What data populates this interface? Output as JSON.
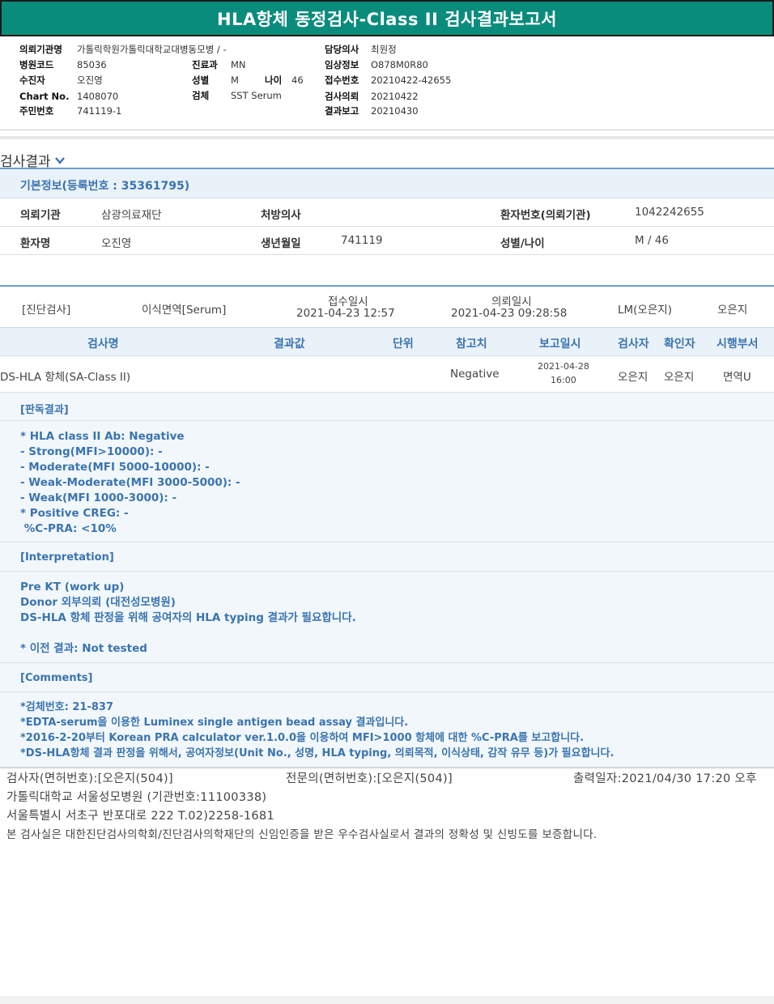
{
  "title": "HLA항체 동정검사-Class II 검사결과보고서",
  "header": {
    "col1": [
      {
        "label": "의뢰기관명",
        "value": "가톨릭학원가톨릭대학교대병동모병 / -"
      },
      {
        "label": "병원코드",
        "value": "85036"
      },
      {
        "label": "수진자",
        "value": "오진영"
      },
      {
        "label": "Chart No.",
        "value": "1408070"
      },
      {
        "label": "주민번호",
        "value": "741119-1"
      }
    ],
    "col2": [
      {
        "label": "진료과",
        "value": "MN"
      },
      {
        "label": "성별",
        "value": "M"
      },
      {
        "label": "나이",
        "value": "46"
      },
      {
        "label": "검체",
        "value": "SST Serum"
      }
    ],
    "col3": [
      {
        "label": "담당의사",
        "value": "최원정"
      },
      {
        "label": "임상정보",
        "value": "O878M0R80"
      },
      {
        "label": "접수번호",
        "value": "20210422-42655"
      },
      {
        "label": "검사의뢰",
        "value": "20210422"
      },
      {
        "label": "결과보고",
        "value": "20210430"
      }
    ]
  },
  "section": {
    "title": "검사결과",
    "basic_info_title": "기본정보(등록번호 : 35361795)"
  },
  "info": {
    "row1": {
      "l1": "의뢰기관",
      "v1": "삼광의료재단",
      "l2": "처방의사",
      "v2": "",
      "l3": "환자번호(의뢰기관)",
      "v3": "1042242655"
    },
    "row2": {
      "l1": "환자명",
      "v1": "오진영",
      "l2": "생년월일",
      "v2": "741119",
      "l3": "성별/나이",
      "v3": "M / 46"
    }
  },
  "rx": {
    "category": "[진단검사]",
    "dept": "이식면역[Serum]",
    "received_label": "접수일시",
    "received": "2021-04-23 12:57",
    "requested_label": "의뢰일시",
    "requested": "2021-04-23 09:28:58",
    "tester": "LM(오은지)",
    "confirmer": "오은지"
  },
  "table": {
    "headers": [
      "검사명",
      "결과값",
      "단위",
      "참고치",
      "보고일시",
      "검사자",
      "확인자",
      "시행부서"
    ],
    "row": {
      "name": "DS-HLA 항체(SA-Class II)",
      "result": "",
      "unit": "",
      "reference": "Negative",
      "report_date": "2021-04-28",
      "report_time": "16:00",
      "tester": "오은지",
      "confirmer": "오은지",
      "dept": "면역U"
    }
  },
  "reading": {
    "title": "[판독결과]",
    "lines": [
      "* HLA class II Ab: Negative",
      "- Strong(MFI>10000): -",
      "- Moderate(MFI 5000-10000): -",
      "- Weak-Moderate(MFI 3000-5000): -",
      "- Weak(MFI 1000-3000): -",
      "* Positive CREG: -",
      " %C-PRA: <10%"
    ]
  },
  "interpretation": {
    "title": "[Interpretation]",
    "lines": [
      "Pre KT (work up)",
      "Donor 외부의뢰 (대전성모병원)",
      "DS-HLA 항체 판정을 위해 공여자의 HLA typing 결과가 필요합니다.",
      "",
      "* 이전 결과: Not tested"
    ]
  },
  "comments": {
    "title": "[Comments]",
    "lines": [
      "*검체번호: 21-837",
      "*EDTA-serum을 이용한 Luminex single antigen bead assay 결과입니다.",
      "*2016-2-20부터 Korean PRA calculator ver.1.0.0을 이용하여 MFI>1000 항체에 대한 %C-PRA를 보고합니다.",
      "*DS-HLA항체 결과 판정을 위해서, 공여자정보(Unit No., 성명, HLA typing, 의뢰목적, 이식상태, 감작 유무 등)가 필요합니다."
    ]
  },
  "footer": {
    "tester": "검사자(면허번호):[오은지(504)]",
    "specialist": "전문의(면허번호):[오은지(504)]",
    "printed": "출력일자:2021/04/30 17:20 오후",
    "hospital": "가톨릭대학교 서울성모병원 (기관번호:11100338)",
    "address": "서울특별시 서초구 반포대로 222 T.02)2258-1681",
    "certification": "본 검사실은 대한진단검사의학회/진단검사의학재단의 신임인증을 받은 우수검사실로서 결과의 정확성 및 신빙도를 보증합니다."
  }
}
